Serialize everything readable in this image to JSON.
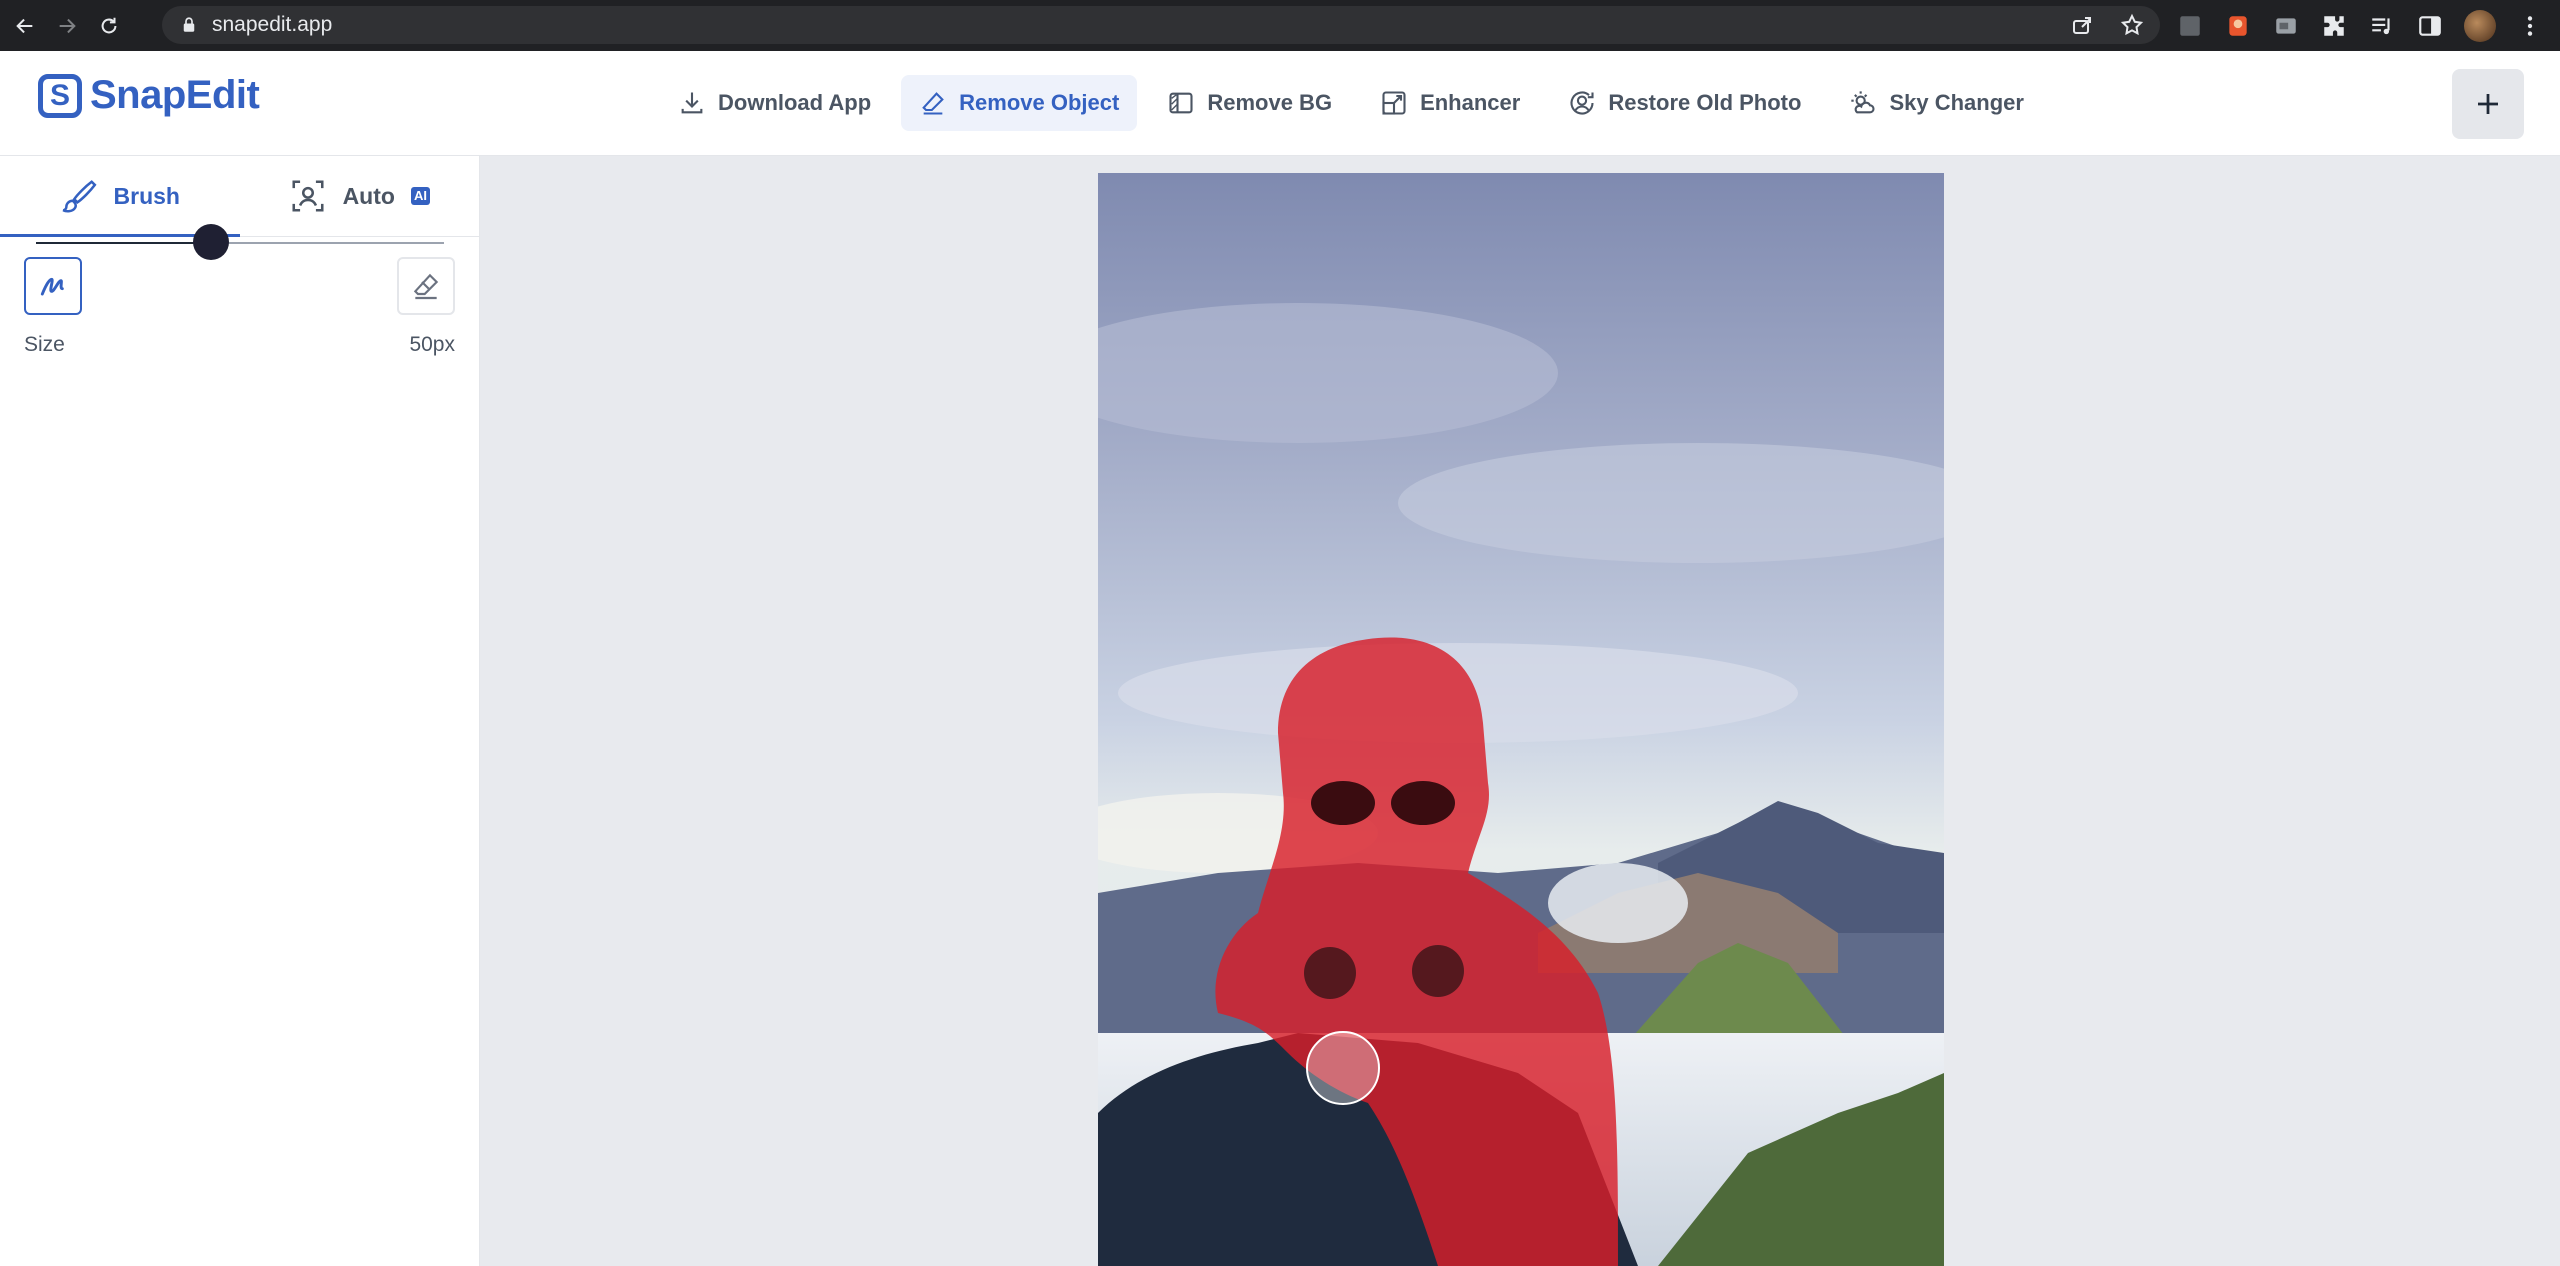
{
  "browser": {
    "url": "snapedit.app"
  },
  "header": {
    "logo_text": "SnapEdit",
    "menu": [
      {
        "label": "Download App"
      },
      {
        "label": "Remove Object"
      },
      {
        "label": "Remove BG"
      },
      {
        "label": "Enhancer"
      },
      {
        "label": "Restore Old Photo"
      },
      {
        "label": "Sky Changer"
      }
    ]
  },
  "sidebar": {
    "tabs": [
      {
        "label": "Brush"
      },
      {
        "label": "Auto"
      }
    ],
    "ai_badge": "AI",
    "size_label": "Size",
    "size_value": "50px",
    "size_slider_fraction": 0.43
  },
  "colors": {
    "brand": "#3461c1",
    "mask": "#d81f2a"
  }
}
